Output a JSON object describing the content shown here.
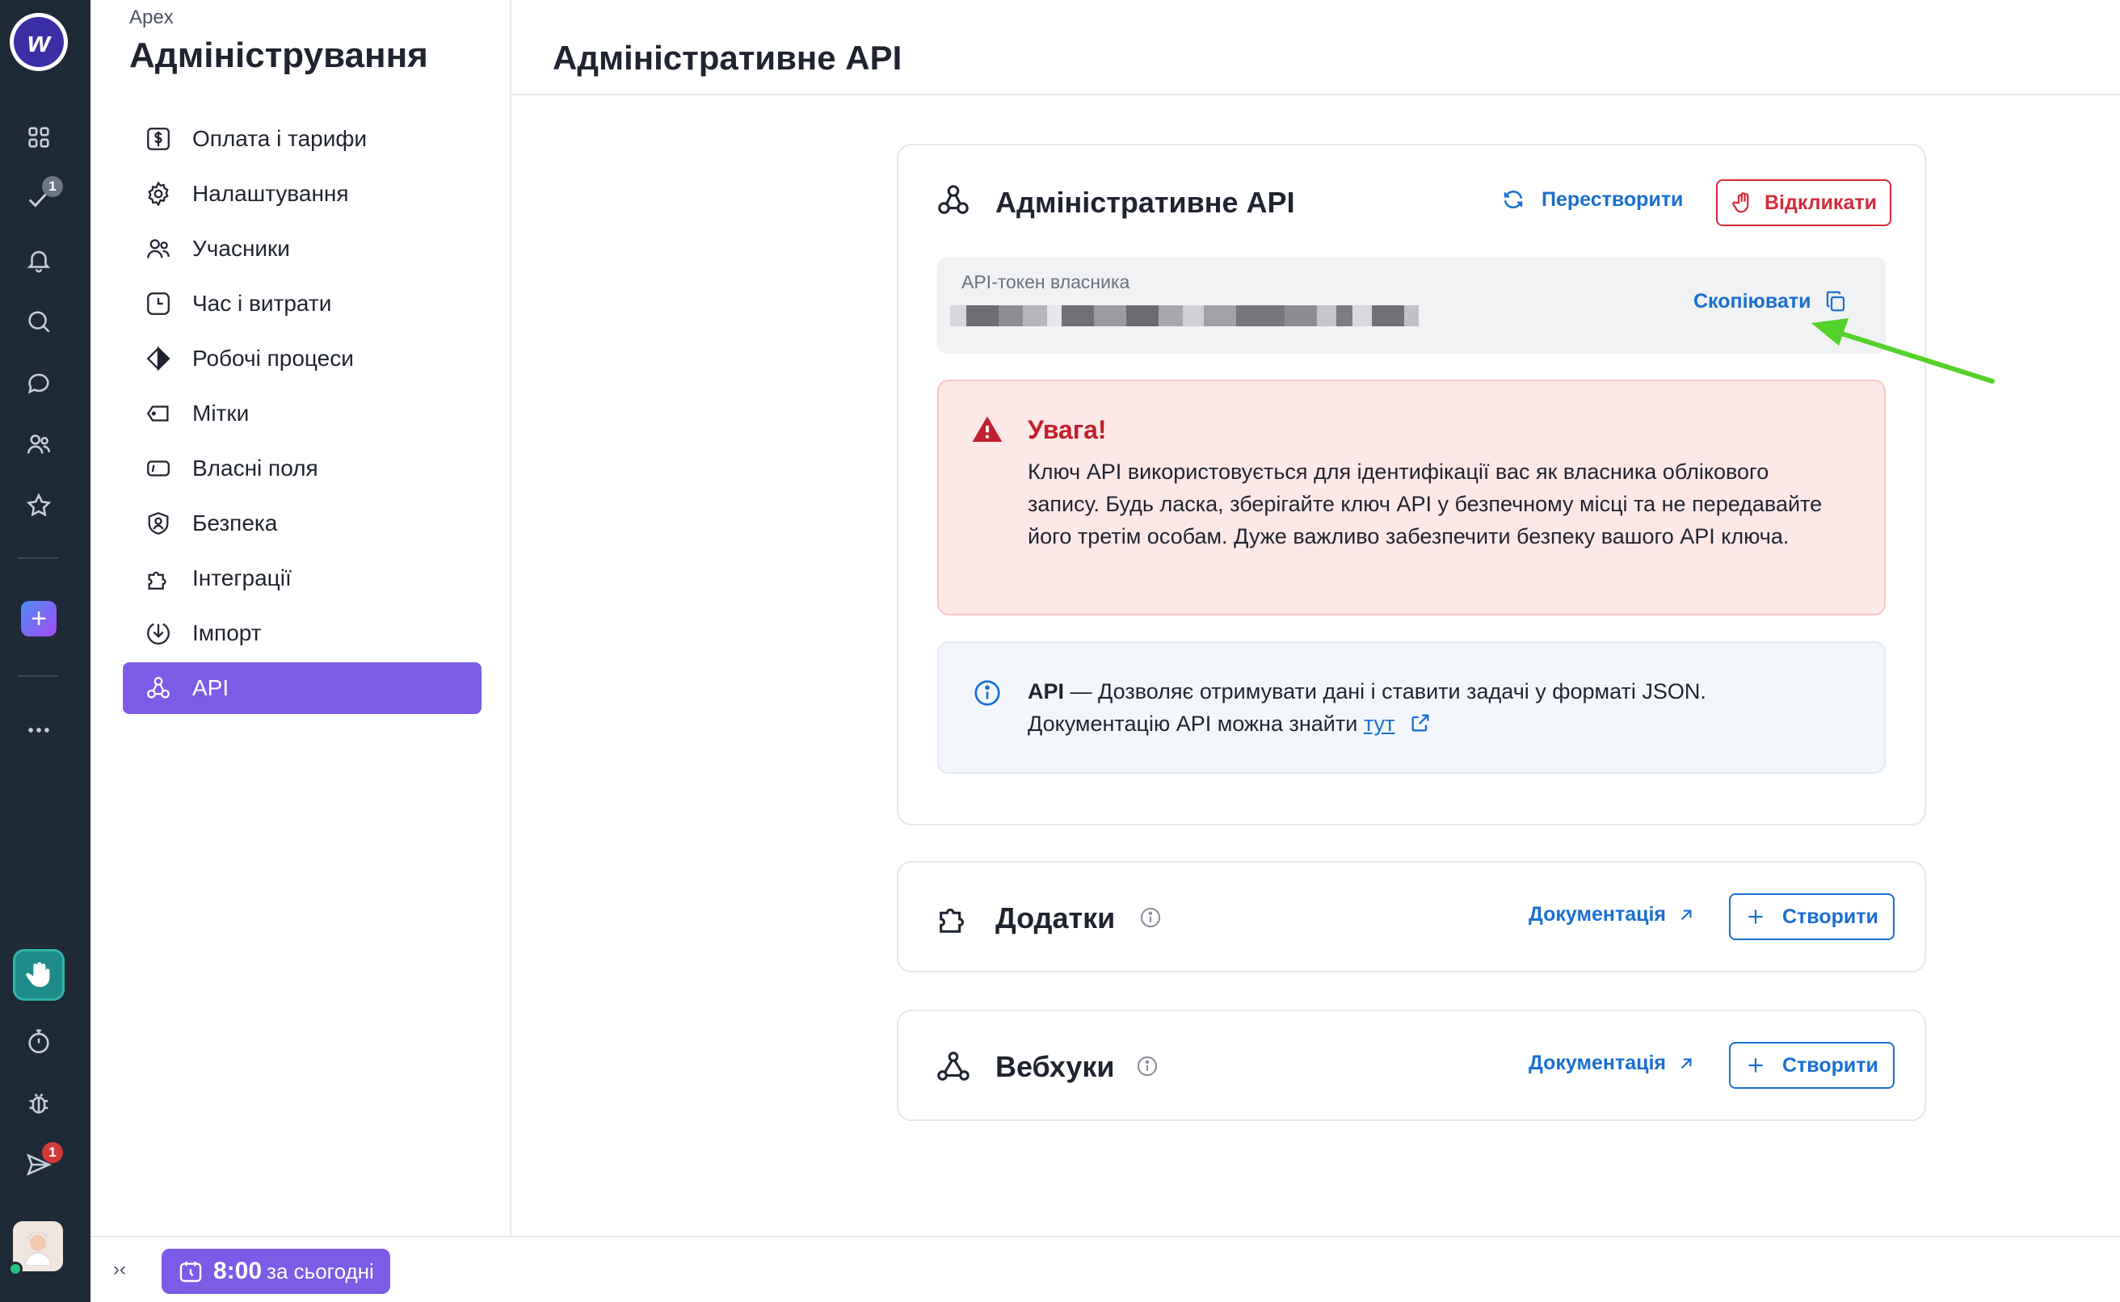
{
  "rail": {
    "logo_letter": "w",
    "badges": {
      "tasks": "1",
      "send": "1"
    }
  },
  "settings": {
    "org": "Apex",
    "title": "Адміністрування",
    "items": [
      {
        "label": "Оплата і тарифи",
        "icon": "dollar-icon"
      },
      {
        "label": "Налаштування",
        "icon": "gear-icon"
      },
      {
        "label": "Учасники",
        "icon": "users-icon"
      },
      {
        "label": "Час і витрати",
        "icon": "clock-icon"
      },
      {
        "label": "Робочі процеси",
        "icon": "workflow-icon"
      },
      {
        "label": "Мітки",
        "icon": "tag-icon"
      },
      {
        "label": "Власні поля",
        "icon": "field-icon"
      },
      {
        "label": "Безпека",
        "icon": "shield-icon"
      },
      {
        "label": "Інтеграції",
        "icon": "puzzle-icon"
      },
      {
        "label": "Імпорт",
        "icon": "import-icon"
      },
      {
        "label": "API",
        "icon": "api-icon"
      }
    ],
    "active_index": 10
  },
  "main": {
    "title": "Адміністративне API",
    "api_card": {
      "title": "Адміністративне API",
      "regenerate_label": "Перестворити",
      "revoke_label": "Відкликати",
      "token_label": "API-токен власника",
      "copy_label": "Скопіювати",
      "warning_title": "Увага!",
      "warning_text": "Ключ API використовується для ідентифікації вас як власника облікового запису. Будь ласка, зберігайте ключ API у безпечному місці та не передавайте його третім особам. Дуже важливо забезпечити безпеку вашого API ключа.",
      "info_bold": "API",
      "info_text_1": " — Дозволяє отримувати дані і ставити задачі у форматі JSON.",
      "info_text_2": "Документацію API можна знайти ",
      "info_link": "тут"
    },
    "addons_card": {
      "title": "Додатки",
      "docs_label": "Документація",
      "create_label": "Створити"
    },
    "webhooks_card": {
      "title": "Вебхуки",
      "docs_label": "Документація",
      "create_label": "Створити"
    }
  },
  "bottom_bar": {
    "timer_value": "8:00",
    "timer_suffix": "за сьогодні"
  },
  "colors": {
    "accent": "#7c5ce6",
    "link": "#1a6fd1",
    "danger": "#d52a3a",
    "rail_bg": "#1f2a37",
    "annotation_arrow": "#52d12a"
  }
}
